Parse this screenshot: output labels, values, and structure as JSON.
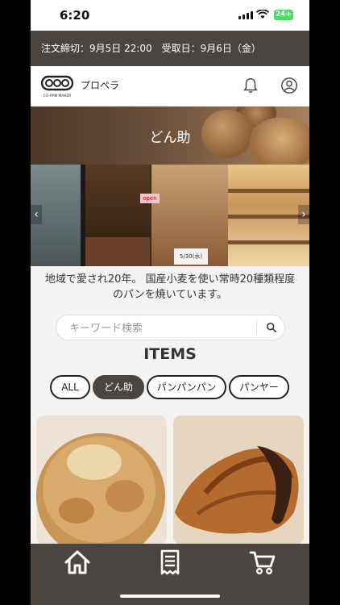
{
  "status_bar": {
    "time": "6:20",
    "battery": "24+"
  },
  "notice": {
    "text": "注文締切：9月5日 22:00　受取日：9月6日（金）"
  },
  "header": {
    "logo_text": "CO-PAN MAKER",
    "shop_name": "プロペラ"
  },
  "banner": {
    "title": "どん助"
  },
  "photo": {
    "sign_text": "open",
    "card_text": "5/30(水)"
  },
  "description": "地域で愛され20年。 国産小麦を使い常時20種類程度のパンを焼いています。",
  "search": {
    "placeholder": "キーワード検索",
    "value": ""
  },
  "items_heading": "ITEMS",
  "categories": [
    {
      "label": "ALL",
      "active": false
    },
    {
      "label": "どん助",
      "active": true
    },
    {
      "label": "パンパンパン",
      "active": false
    },
    {
      "label": "パンヤー",
      "active": false
    }
  ],
  "bottom_nav": [
    {
      "icon": "home-icon"
    },
    {
      "icon": "receipt-icon"
    },
    {
      "icon": "cart-icon"
    }
  ],
  "colors": {
    "accent": "#4a4540",
    "battery": "#4cd964",
    "background": "#f4f3f2"
  }
}
